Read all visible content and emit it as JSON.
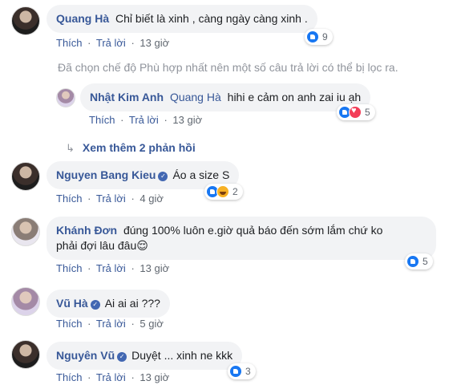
{
  "actions": {
    "like": "Thích",
    "reply": "Trả lời",
    "separator": "·"
  },
  "comments": [
    {
      "name": "Quang Hà",
      "verified": false,
      "text": "Chỉ biết là xinh , càng ngày càng xinh .",
      "time": "13 giờ",
      "reactions": [
        "like"
      ],
      "count": "9"
    },
    {
      "name": "Nhật Kim Anh",
      "verified": false,
      "mention": "Quang Hà",
      "text": "hihi e cảm on anh zai iu ạh",
      "time": "13 giờ",
      "reactions": [
        "like",
        "love"
      ],
      "count": "5"
    },
    {
      "name": "Nguyen Bang Kieu",
      "verified": true,
      "text": "Áo a size S",
      "time": "4 giờ",
      "reactions": [
        "like",
        "haha"
      ],
      "count": "2"
    },
    {
      "name": "Khánh Đơn",
      "verified": false,
      "text_line1": "đúng 100% luôn e.giờ quả báo đến sớm lắm chứ ko",
      "text_line2": "phải đợi lâu đâu😌",
      "time": "13 giờ",
      "reactions": [
        "like"
      ],
      "count": "5"
    },
    {
      "name": "Vũ Hà",
      "verified": true,
      "text": "Ai ai ai ???",
      "time": "5 giờ",
      "reactions": [],
      "count": ""
    },
    {
      "name": "Nguyên Vũ",
      "verified": true,
      "text": "Duyệt ... xinh ne kkk",
      "time": "13 giờ",
      "reactions": [
        "like"
      ],
      "count": "3"
    }
  ],
  "filter_note": "Đã chọn chế độ Phù hợp nhất nên một số câu trả lời có thể bị lọc ra.",
  "view_more": "Xem thêm 2 phản hồi",
  "icons": {
    "verified": "verified-badge-icon",
    "like": "like-reaction-icon",
    "love": "love-reaction-icon",
    "haha": "haha-reaction-icon",
    "reply_arrow": "reply-arrow-icon"
  },
  "colors": {
    "name": "#385898",
    "bubble": "#f2f3f5",
    "meta": "#606770",
    "note": "#90949c",
    "like": "#1877f2"
  }
}
